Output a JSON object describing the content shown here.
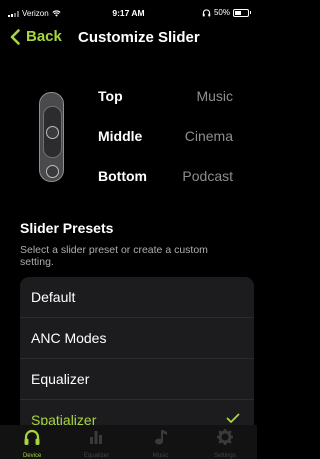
{
  "status_bar": {
    "carrier": "Verizon",
    "time": "9:17 AM",
    "battery": "50%"
  },
  "nav": {
    "back_label": "Back",
    "title": "Customize Slider"
  },
  "slider_positions": [
    {
      "position": "Top",
      "value": "Music"
    },
    {
      "position": "Middle",
      "value": "Cinema"
    },
    {
      "position": "Bottom",
      "value": "Podcast"
    }
  ],
  "presets": {
    "title": "Slider Presets",
    "description": "Select a slider preset or create a custom setting.",
    "items": [
      {
        "label": "Default",
        "selected": false
      },
      {
        "label": "ANC Modes",
        "selected": false
      },
      {
        "label": "Equalizer",
        "selected": false
      },
      {
        "label": "Spatializer",
        "selected": true
      }
    ]
  },
  "tab_bar": {
    "tabs": [
      {
        "label": "Device",
        "icon": "headphones-icon",
        "active": true
      },
      {
        "label": "Equalizer",
        "icon": "equalizer-icon",
        "active": false
      },
      {
        "label": "Music",
        "icon": "music-note-icon",
        "active": false
      },
      {
        "label": "Settings",
        "icon": "gear-icon",
        "active": false
      }
    ]
  },
  "colors": {
    "accent": "#a5d63f",
    "background": "#000000",
    "card": "#1c1c1e",
    "secondary_text": "#8e8e93"
  }
}
